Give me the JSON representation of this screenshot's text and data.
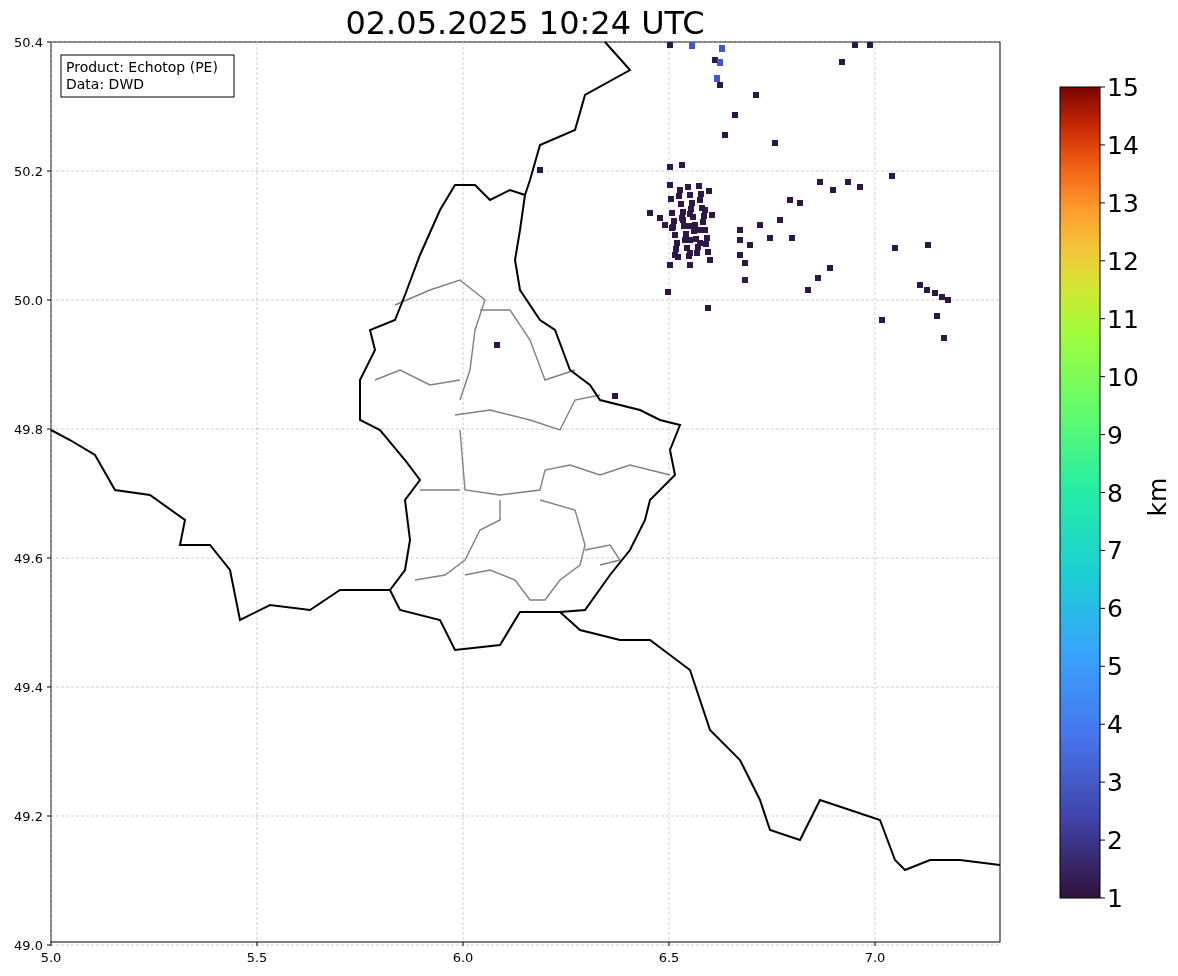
{
  "title": "02.05.2025 10:24 UTC",
  "info_box": [
    "Product: Echotop (PE)",
    "Data: DWD"
  ],
  "x_ticks": [
    "5.0",
    "5.5",
    "6.0",
    "6.5",
    "7.0"
  ],
  "y_ticks": [
    "50.4",
    "50.2",
    "50.0",
    "49.8",
    "49.6",
    "49.4",
    "49.2",
    "49.0"
  ],
  "colorbar": {
    "label": "km",
    "ticks": [
      "15",
      "14",
      "13",
      "12",
      "11",
      "10",
      "9",
      "8",
      "7",
      "6",
      "5",
      "4",
      "3",
      "2",
      "1"
    ]
  }
}
